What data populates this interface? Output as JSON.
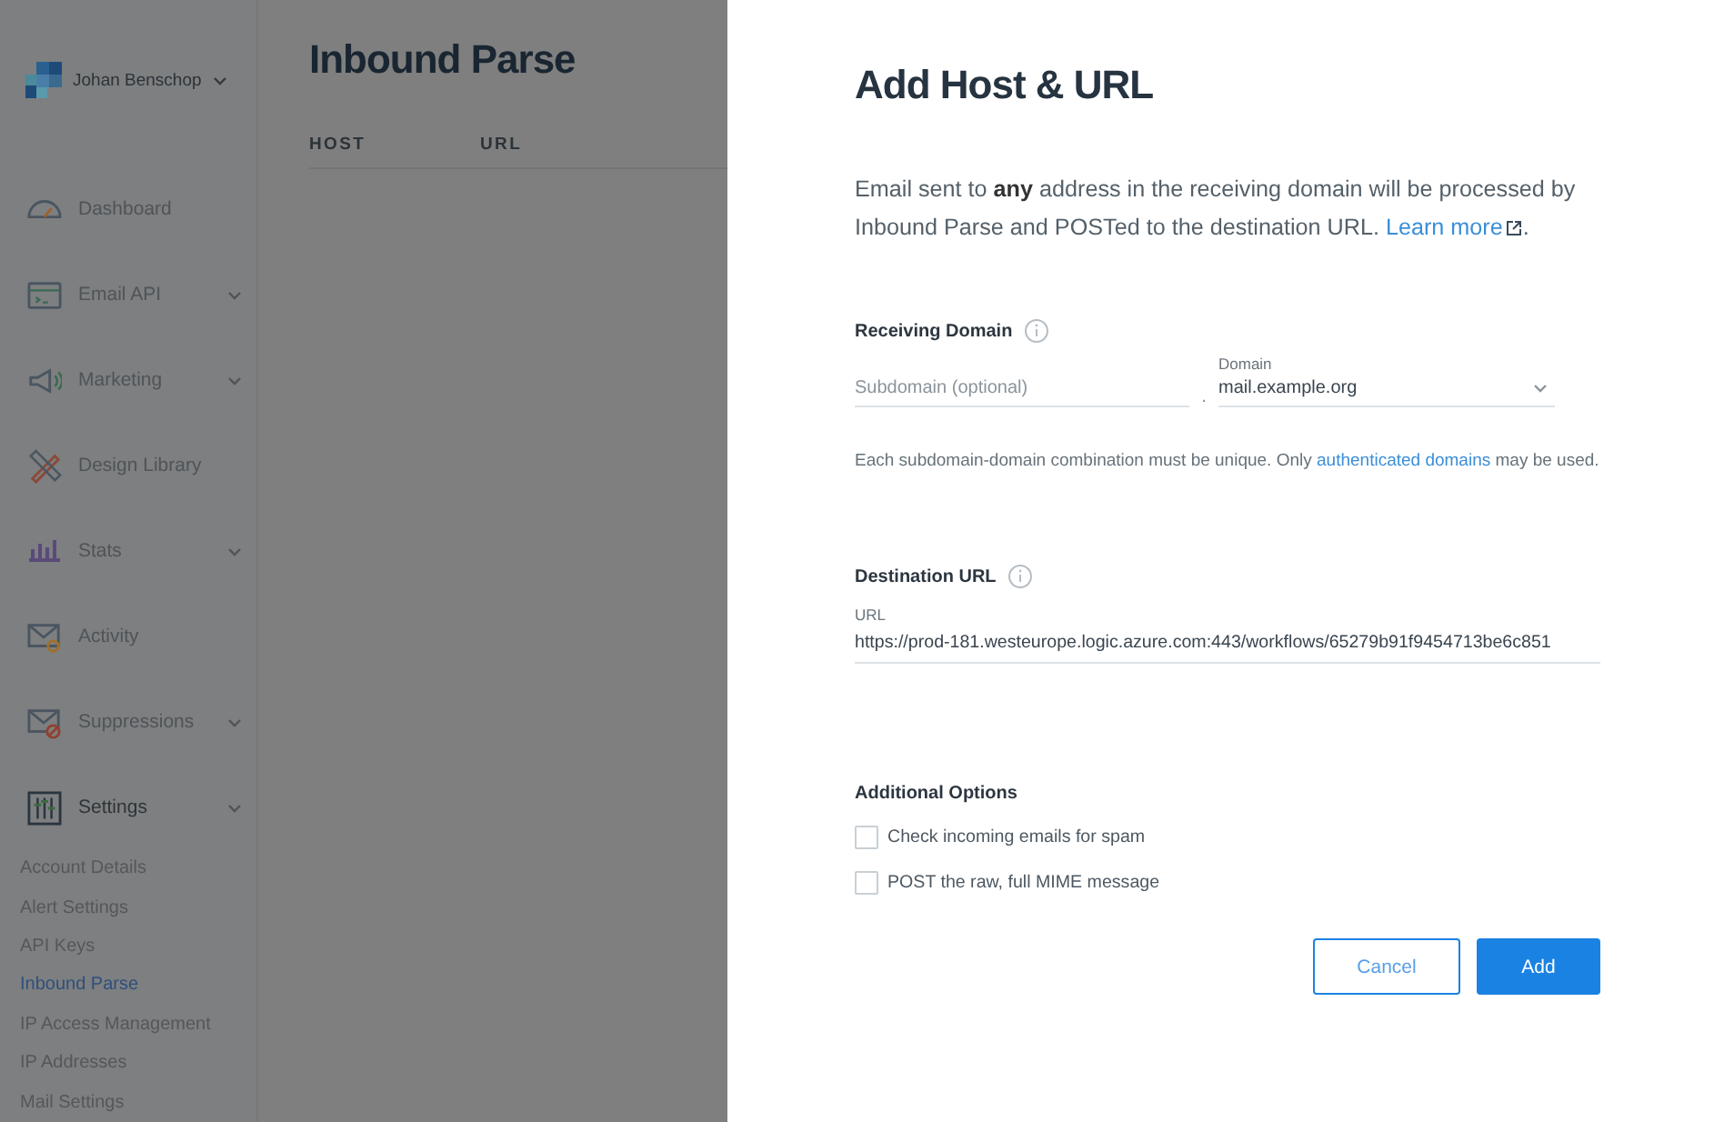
{
  "sidebar": {
    "account_name": "Johan Benschop",
    "nav_items": [
      {
        "label": "Dashboard",
        "kind": "gauge",
        "expandable": false
      },
      {
        "label": "Email API",
        "kind": "terminal",
        "expandable": true
      },
      {
        "label": "Marketing",
        "kind": "megaphone",
        "expandable": true
      },
      {
        "label": "Design Library",
        "kind": "tools",
        "expandable": false
      },
      {
        "label": "Stats",
        "kind": "chart",
        "expandable": true
      },
      {
        "label": "Activity",
        "kind": "mail-search",
        "expandable": false
      },
      {
        "label": "Suppressions",
        "kind": "mail-block",
        "expandable": true
      },
      {
        "label": "Settings",
        "kind": "sliders",
        "expandable": true
      }
    ],
    "sub_items": [
      {
        "label": "Account Details",
        "selected": false
      },
      {
        "label": "Alert Settings",
        "selected": false
      },
      {
        "label": "API Keys",
        "selected": false
      },
      {
        "label": "Inbound Parse",
        "selected": true
      },
      {
        "label": "IP Access Management",
        "selected": false
      },
      {
        "label": "IP Addresses",
        "selected": false
      },
      {
        "label": "Mail Settings",
        "selected": false
      }
    ]
  },
  "page": {
    "title": "Inbound Parse",
    "columns": [
      "HOST",
      "URL"
    ]
  },
  "dialog": {
    "title": "Add Host & URL",
    "intro": "Email sent to **any** address in the receiving domain will be processed by Inbound Parse and POSTed to the destination URL.",
    "intro_link": "Learn more",
    "intro_end": ".",
    "receiving_domain": {
      "heading": "Receiving Domain",
      "subdomain_placeholder": "Subdomain (optional)",
      "separator": ".",
      "domain_label": "Domain",
      "domain_value": "mail.example.org",
      "hint": "Each subdomain-domain combination must be unique. Only",
      "hint_link": "authenticated domains",
      "hint_end": "may be used."
    },
    "destination": {
      "heading": "Destination URL",
      "url_label": "URL",
      "url_value": "https://prod-181.westeurope.logic.azure.com:443/workflows/65279b91f9454713be6c851"
    },
    "options_heading": "Additional Options",
    "options": [
      {
        "label": "Check incoming emails for spam",
        "checked": false
      },
      {
        "label": "POST the raw, full MIME message",
        "checked": false
      }
    ],
    "buttons": [
      {
        "label": "Cancel",
        "kind": "secondary"
      },
      {
        "label": "Add",
        "kind": "primary"
      }
    ]
  }
}
